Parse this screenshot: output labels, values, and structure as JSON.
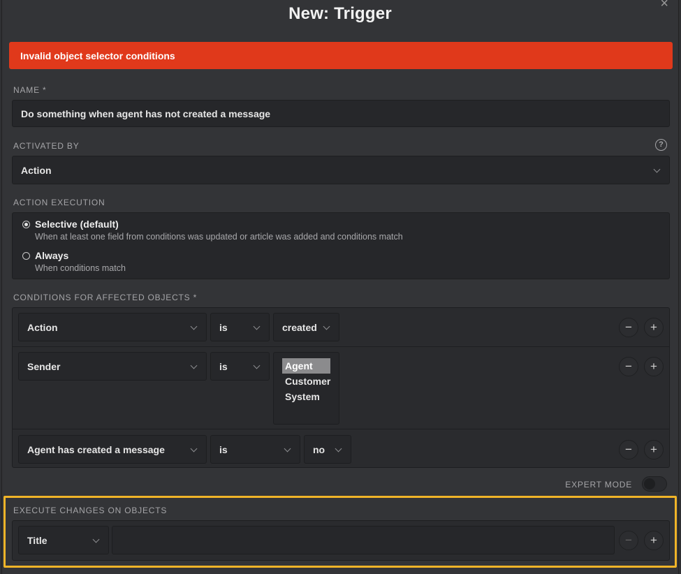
{
  "dialog": {
    "title": "New: Trigger",
    "close": "×"
  },
  "alert": {
    "message": "Invalid object selector conditions",
    "color": "#e0391b"
  },
  "name": {
    "label": "NAME *",
    "value": "Do something when agent has not created a message"
  },
  "activated_by": {
    "label": "ACTIVATED BY",
    "value": "Action",
    "help": "?"
  },
  "action_execution": {
    "label": "ACTION EXECUTION",
    "options": [
      {
        "title": "Selective (default)",
        "desc": "When at least one field from conditions was updated or article was added and conditions match",
        "selected": true
      },
      {
        "title": "Always",
        "desc": "When conditions match",
        "selected": false
      }
    ]
  },
  "conditions": {
    "label": "CONDITIONS FOR AFFECTED OBJECTS *",
    "rows": [
      {
        "attribute": "Action",
        "operator": "is",
        "value": "created"
      },
      {
        "attribute": "Sender",
        "operator": "is",
        "options": [
          "Agent",
          "Customer",
          "System"
        ],
        "selected": "Agent"
      },
      {
        "attribute": "Agent has created a message",
        "operator": "is",
        "value": "no"
      }
    ],
    "minus": "−",
    "plus": "+"
  },
  "expert_mode": {
    "label": "EXPERT MODE",
    "enabled": false
  },
  "execute": {
    "label": "EXECUTE CHANGES ON OBJECTS",
    "attribute": "Title",
    "value": "",
    "minus": "−",
    "plus": "+"
  },
  "highlight_color": "#f0b428"
}
